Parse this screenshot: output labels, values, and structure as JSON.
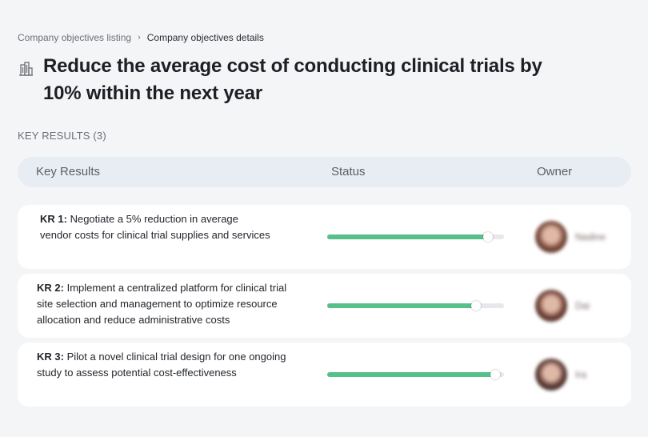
{
  "breadcrumb": {
    "parent": "Company objectives listing",
    "separator": "›",
    "current": "Company objectives details"
  },
  "objective": {
    "icon": "building-icon",
    "title": "Reduce the average cost of conducting clinical trials by 10% within the next year"
  },
  "key_results_label": "KEY RESULTS (3)",
  "table": {
    "headers": {
      "key_results": "Key Results",
      "status": "Status",
      "owner": "Owner"
    },
    "rows": [
      {
        "kr_label": "KR 1:",
        "text": "Negotiate a 5% reduction in average vendor costs for clinical trial supplies and services",
        "progress": 0.91,
        "owner_name": "Nadine",
        "avatar_color": "#7a4a3c"
      },
      {
        "kr_label": "KR 2:",
        "text": "Implement a centralized platform for clinical trial site selection and management to optimize resource allocation and reduce administrative costs",
        "progress": 0.84,
        "owner_name": "Dai",
        "avatar_color": "#6e4034"
      },
      {
        "kr_label": "KR 3:",
        "text": "Pilot a novel clinical trial design for one ongoing study to assess potential cost-effectiveness",
        "progress": 0.95,
        "owner_name": "Ira",
        "avatar_color": "#5a3a33"
      }
    ]
  },
  "colors": {
    "background": "#f4f5f7",
    "header_bg": "#e8ecf3",
    "progress_fill": "#56c08a",
    "progress_track": "#e6e8eb"
  }
}
